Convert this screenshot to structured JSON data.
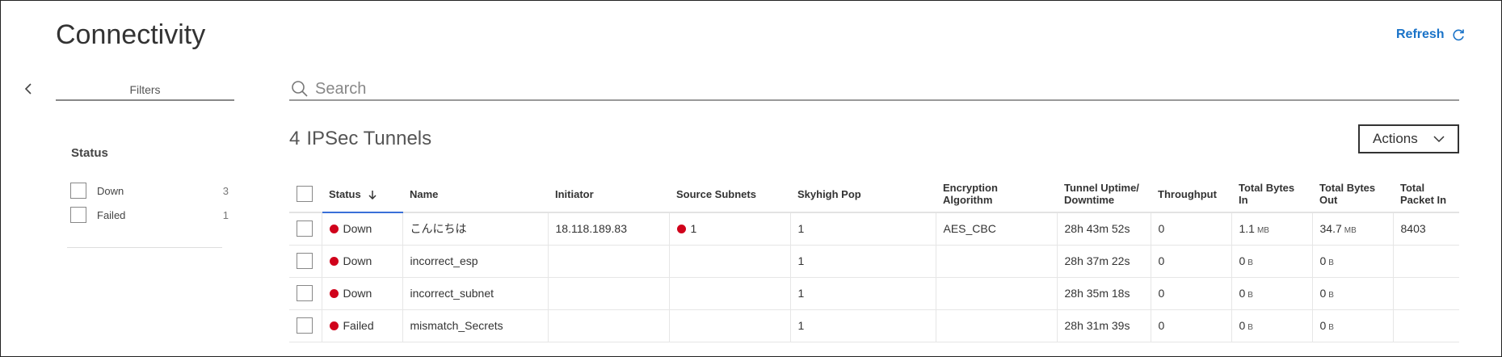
{
  "page": {
    "title": "Connectivity"
  },
  "refresh": {
    "label": "Refresh",
    "icon": "refresh-icon"
  },
  "colors": {
    "accent": "#1a73c8",
    "status_down": "#d0021b",
    "sort_underline": "#3a6fd8"
  },
  "filters": {
    "tab_label": "Filters",
    "status_heading": "Status",
    "options": [
      {
        "label": "Down",
        "count": "3"
      },
      {
        "label": "Failed",
        "count": "1"
      }
    ]
  },
  "search": {
    "placeholder": "Search"
  },
  "summary": {
    "count": "4",
    "label": "IPSec Tunnels"
  },
  "actions": {
    "label": "Actions"
  },
  "table": {
    "columns": [
      "Status",
      "Name",
      "Initiator",
      "Source Subnets",
      "Skyhigh Pop",
      "Encryption Algorithm",
      "Tunnel Uptime/ Downtime",
      "Throughput",
      "Total Bytes In",
      "Total Bytes Out",
      "Total Packet In"
    ],
    "rows": [
      {
        "status": "Down",
        "name": "こんにちは",
        "initiator": "18.118.189.83",
        "source_subnets": "1",
        "pop": "1",
        "encryption": "AES_CBC",
        "uptime": "28h 43m 52s",
        "throughput": "0",
        "bytes_in": "1.1",
        "bytes_in_unit": "MB",
        "bytes_out": "34.7",
        "bytes_out_unit": "MB",
        "packets_in": "8403"
      },
      {
        "status": "Down",
        "name": "incorrect_esp",
        "initiator": "",
        "source_subnets": "",
        "pop": "1",
        "encryption": "",
        "uptime": "28h 37m 22s",
        "throughput": "0",
        "bytes_in": "0",
        "bytes_in_unit": "B",
        "bytes_out": "0",
        "bytes_out_unit": "B",
        "packets_in": ""
      },
      {
        "status": "Down",
        "name": "incorrect_subnet",
        "initiator": "",
        "source_subnets": "",
        "pop": "1",
        "encryption": "",
        "uptime": "28h 35m 18s",
        "throughput": "0",
        "bytes_in": "0",
        "bytes_in_unit": "B",
        "bytes_out": "0",
        "bytes_out_unit": "B",
        "packets_in": ""
      },
      {
        "status": "Failed",
        "name": "mismatch_Secrets",
        "initiator": "",
        "source_subnets": "",
        "pop": "1",
        "encryption": "",
        "uptime": "28h 31m 39s",
        "throughput": "0",
        "bytes_in": "0",
        "bytes_in_unit": "B",
        "bytes_out": "0",
        "bytes_out_unit": "B",
        "packets_in": ""
      }
    ]
  }
}
